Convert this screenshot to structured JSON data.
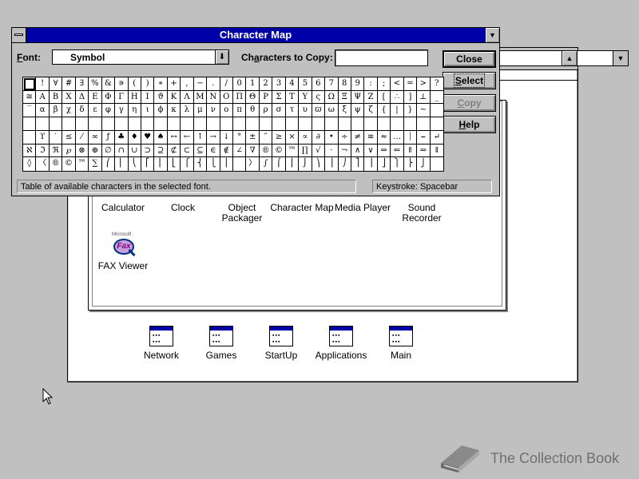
{
  "program_manager": {
    "groups": [
      {
        "label": "Network"
      },
      {
        "label": "Games"
      },
      {
        "label": "StartUp"
      },
      {
        "label": "Applications"
      },
      {
        "label": "Main"
      }
    ],
    "accessories": [
      {
        "label": "Calculator"
      },
      {
        "label": "Clock"
      },
      {
        "label": "Object\nPackager",
        "l1": "Object",
        "l2": "Packager"
      },
      {
        "label": "Character Map"
      },
      {
        "label": "Media Player"
      },
      {
        "label": "Sound Recorder",
        "l1": "Sound",
        "l2": "Recorder"
      },
      {
        "label": "FAX Viewer",
        "badge": "Microsoft",
        "glyph": "Fax"
      }
    ]
  },
  "charmap": {
    "title": "Character Map",
    "font_label": "Font:",
    "font_value": "Symbol",
    "copy_label": "Characters to Copy:",
    "copy_value": "",
    "buttons": {
      "close": "Close",
      "select": "Select",
      "copy": "Copy",
      "help": "Help"
    },
    "grid_rows": [
      [
        " ",
        "!",
        "∀",
        "#",
        "∃",
        "%",
        "&",
        "∍",
        "(",
        ")",
        "∗",
        "+",
        ",",
        "−",
        ".",
        "/",
        "0",
        "1",
        "2",
        "3",
        "4",
        "5",
        "6",
        "7",
        "8",
        "9",
        ":",
        ";",
        "<",
        "=",
        ">",
        "?"
      ],
      [
        "≅",
        "Α",
        "Β",
        "Χ",
        "Δ",
        "Ε",
        "Φ",
        "Γ",
        "Η",
        "Ι",
        "ϑ",
        "Κ",
        "Λ",
        "Μ",
        "Ν",
        "Ο",
        "Π",
        "Θ",
        "Ρ",
        "Σ",
        "Τ",
        "Υ",
        "ς",
        "Ω",
        "Ξ",
        "Ψ",
        "Ζ",
        "[",
        "∴",
        "]",
        "⊥",
        "_"
      ],
      [
        "‾",
        "α",
        "β",
        "χ",
        "δ",
        "ε",
        "φ",
        "γ",
        "η",
        "ι",
        "ϕ",
        "κ",
        "λ",
        "μ",
        "ν",
        "ο",
        "π",
        "θ",
        "ρ",
        "σ",
        "τ",
        "υ",
        "ϖ",
        "ω",
        "ξ",
        "ψ",
        "ζ",
        "{",
        "|",
        "}",
        "~",
        ""
      ],
      [
        "",
        "",
        "",
        "",
        "",
        "",
        "",
        "",
        "",
        "",
        "",
        "",
        "",
        "",
        "",
        "",
        "",
        "",
        "",
        "",
        "",
        "",
        "",
        "",
        "",
        "",
        "",
        "",
        "",
        "",
        "",
        ""
      ],
      [
        "",
        "ϒ",
        "′",
        "≤",
        "⁄",
        "∞",
        "ƒ",
        "♣",
        "♦",
        "♥",
        "♠",
        "↔",
        "←",
        "↑",
        "→",
        "↓",
        "°",
        "±",
        "″",
        "≥",
        "×",
        "∝",
        "∂",
        "•",
        "÷",
        "≠",
        "≡",
        "≈",
        "…",
        "⏐",
        "⎯",
        "↵"
      ],
      [
        "ℵ",
        "ℑ",
        "ℜ",
        "℘",
        "⊗",
        "⊕",
        "∅",
        "∩",
        "∪",
        "⊃",
        "⊇",
        "⊄",
        "⊂",
        "⊆",
        "∈",
        "∉",
        "∠",
        "∇",
        "®",
        "©",
        "™",
        "∏",
        "√",
        "⋅",
        "¬",
        "∧",
        "∨",
        "⇔",
        "⇐",
        "⇑",
        "⇒",
        "⇓"
      ],
      [
        "◊",
        "〈",
        "®",
        "©",
        "™",
        "∑",
        "⎛",
        "⎜",
        "⎝",
        "⎡",
        "⎢",
        "⎣",
        "⎧",
        "⎨",
        "⎩",
        "⎪",
        "",
        "〉",
        "∫",
        "⌠",
        "⎮",
        "⌡",
        "⎞",
        "⎟",
        "⎠",
        "⎤",
        "⎥",
        "⎦",
        "⎫",
        "⎬",
        "⎭",
        ""
      ]
    ],
    "status_text": "Table of available characters in the selected font.",
    "keystroke_text": "Keystroke: Spacebar"
  },
  "watermark": {
    "text": "The Collection Book"
  }
}
